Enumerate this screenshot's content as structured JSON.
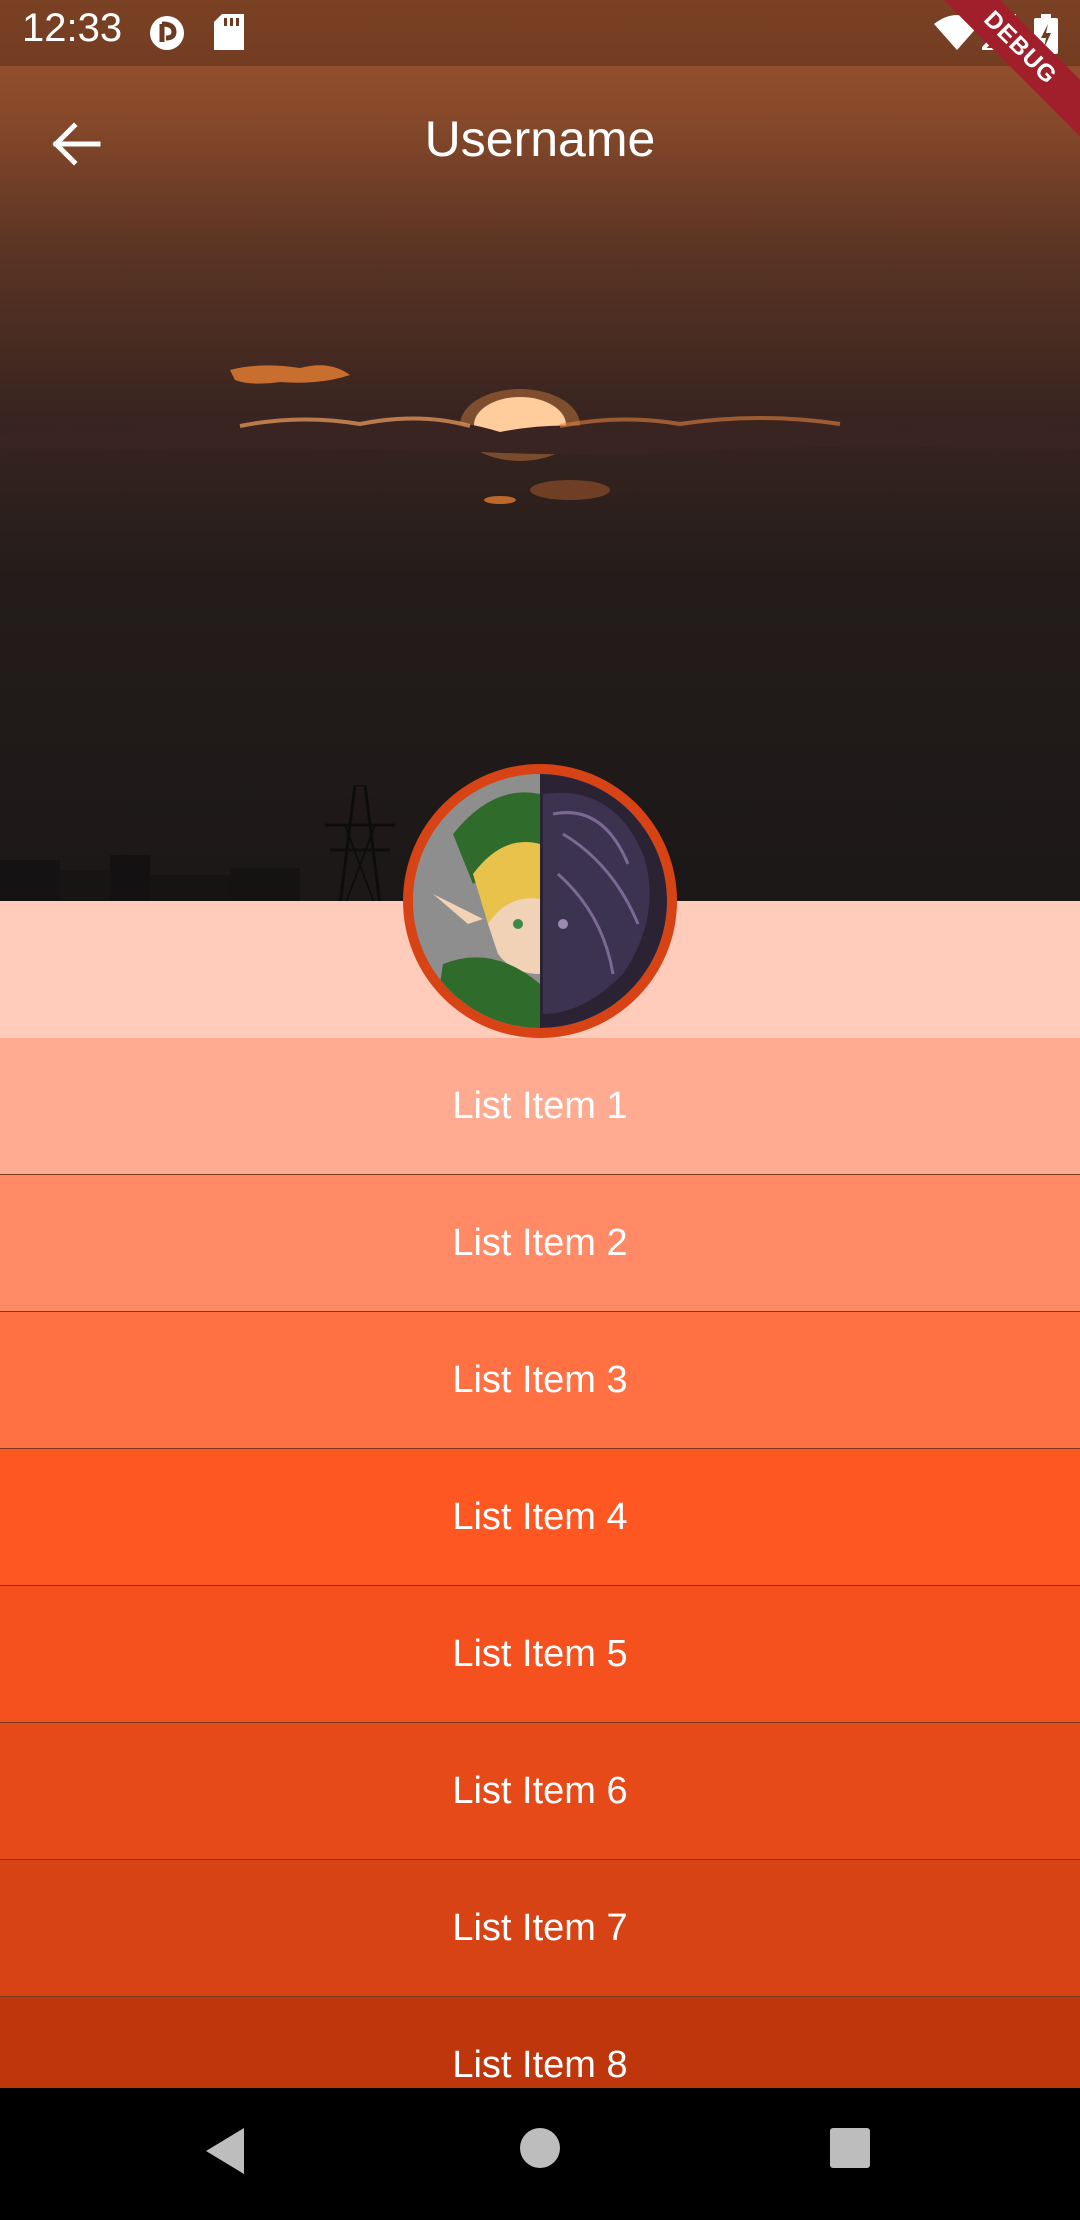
{
  "status_bar": {
    "time": "12:33",
    "icons": [
      "data-saver-icon",
      "sd-card-icon",
      "wifi-icon",
      "signal-icon",
      "battery-charging-icon"
    ]
  },
  "debug_banner": "DEBUG",
  "app_bar": {
    "title": "Username",
    "back_icon": "arrow-back-icon"
  },
  "list": {
    "items": [
      {
        "label": "List Item 1",
        "color": "#ffab91"
      },
      {
        "label": "List Item 2",
        "color": "#ff8a65"
      },
      {
        "label": "List Item 3",
        "color": "#ff7043"
      },
      {
        "label": "List Item 4",
        "color": "#ff5722"
      },
      {
        "label": "List Item 5",
        "color": "#f4511e"
      },
      {
        "label": "List Item 6",
        "color": "#e64a19"
      },
      {
        "label": "List Item 7",
        "color": "#d84315"
      },
      {
        "label": "List Item 8",
        "color": "#bf360c"
      }
    ]
  },
  "nav_bar": {
    "buttons": [
      "back-triangle-icon",
      "home-circle-icon",
      "recents-square-icon"
    ]
  },
  "colors": {
    "profile_band": "#ffccbc",
    "avatar_ring": "#d84315"
  }
}
